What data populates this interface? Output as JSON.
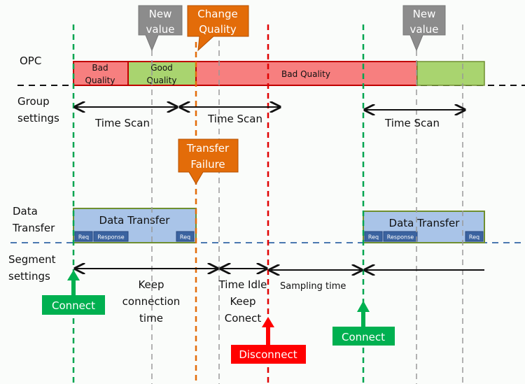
{
  "rows": {
    "opc": "OPC",
    "group_settings": [
      "Group",
      "settings"
    ],
    "data_transfer": [
      "Data",
      "Transfer"
    ],
    "segment_settings": [
      "Segment",
      "settings"
    ]
  },
  "opc_states": [
    {
      "label": [
        "Bad",
        "Quality"
      ],
      "state": "bad"
    },
    {
      "label": [
        "Good",
        "Quality"
      ],
      "state": "good"
    },
    {
      "label": [
        "Bad Quality"
      ],
      "state": "bad"
    },
    {
      "label": [],
      "state": "good"
    }
  ],
  "callouts": {
    "new_value_1": [
      "New",
      "value"
    ],
    "change_quality": [
      "Change",
      "Quality"
    ],
    "new_value_2": [
      "New",
      "value"
    ],
    "transfer_failure": [
      "Transfer",
      "Failure"
    ]
  },
  "group_intervals": [
    "Time Scan",
    "Time Scan",
    "Time Scan"
  ],
  "data_transfer_boxes": [
    {
      "title": "Data Transfer",
      "chips": [
        "Req",
        "Response",
        "Req"
      ]
    },
    {
      "title": "Data Transfer",
      "chips": [
        "Req",
        "Response",
        "Req"
      ]
    }
  ],
  "segment_intervals": {
    "keep_connection": [
      "Keep",
      "connection",
      "time"
    ],
    "time_idle": [
      "Time Idle",
      "Keep",
      "Conect"
    ],
    "sampling": "Sampling time"
  },
  "events": {
    "connect_1": "Connect",
    "disconnect": "Disconnect",
    "connect_2": "Connect"
  },
  "colors": {
    "bad": "#f77f7f",
    "good": "#a9d46f",
    "connect": "#00b050",
    "disconnect": "#ff0000",
    "orange": "#e36c09",
    "gray_callout": "#8c8c8c",
    "transfer_box": "#a9c4e8"
  }
}
